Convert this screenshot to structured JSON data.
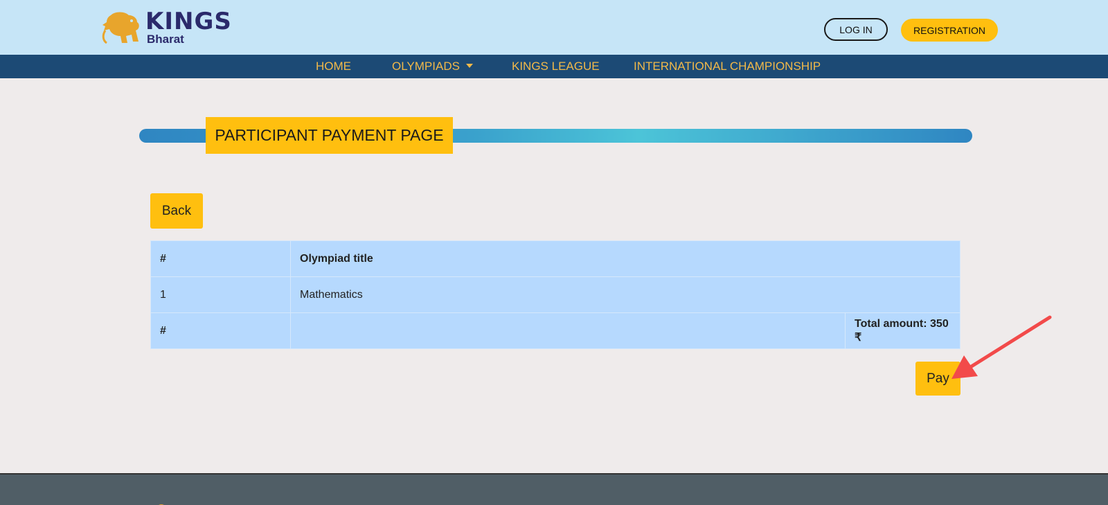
{
  "header": {
    "logo_main": "KINGS",
    "logo_sub": "Bharat",
    "login_label": "LOG IN",
    "registration_label": "REGISTRATION"
  },
  "nav": {
    "items": [
      {
        "label": "HOME"
      },
      {
        "label": "OLYMPIADS",
        "has_dropdown": true
      },
      {
        "label": "KINGS LEAGUE"
      },
      {
        "label": "INTERNATIONAL CHAMPIONSHIP"
      }
    ]
  },
  "page": {
    "title": "PARTICIPANT PAYMENT PAGE",
    "back_label": "Back",
    "pay_label": "Pay"
  },
  "table": {
    "headers": [
      "#",
      "Olympiad title"
    ],
    "rows": [
      {
        "num": "1",
        "title": "Mathematics"
      }
    ],
    "footer_num": "#",
    "total_label": "Total amount: 350 ₹"
  },
  "colors": {
    "accent_yellow": "#ffbf0f",
    "nav_blue": "#1c4a75",
    "header_bg": "#c6e5f7",
    "table_bg": "#b6d9fe",
    "footer_bg": "#505e66",
    "annotation_arrow": "#f24a4a"
  }
}
